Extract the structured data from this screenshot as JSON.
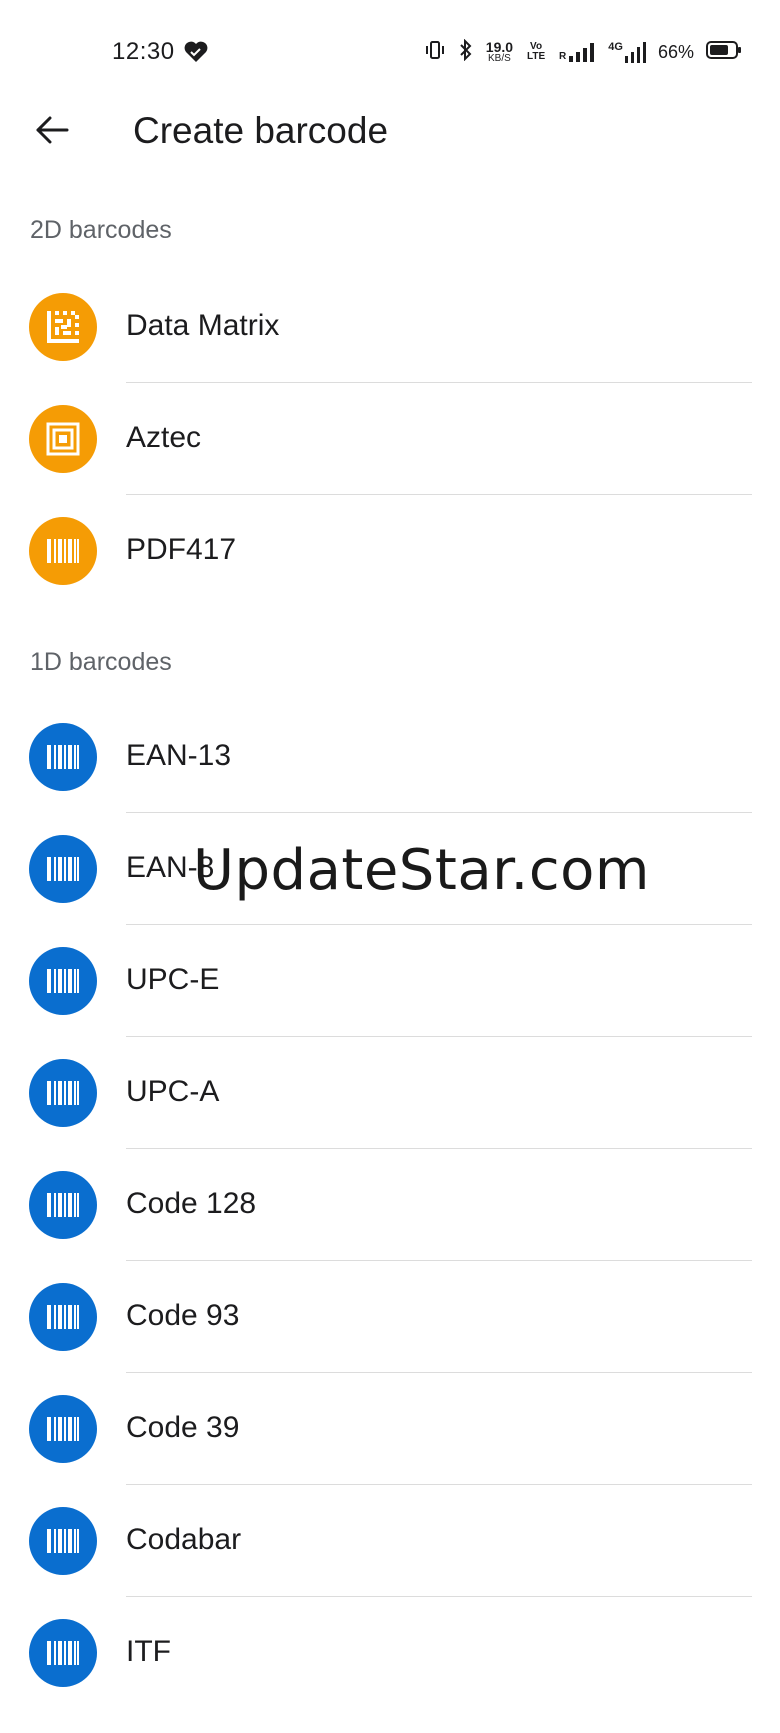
{
  "status_bar": {
    "time": "12:30",
    "net_speed_value": "19.0",
    "net_speed_unit": "KB/S",
    "volte_label": "Vo LTE",
    "roaming_label": "R",
    "network_label": "4G",
    "battery_percent": "66%",
    "icons": [
      "heart-icon",
      "vibrate-icon",
      "bluetooth-icon",
      "signal-icon",
      "battery-icon"
    ]
  },
  "app_bar": {
    "title": "Create barcode",
    "back_icon": "arrow-back-icon"
  },
  "sections": {
    "two_d": {
      "header": "2D barcodes",
      "items": [
        {
          "label": "Data Matrix",
          "icon": "data-matrix-icon"
        },
        {
          "label": "Aztec",
          "icon": "aztec-icon"
        },
        {
          "label": "PDF417",
          "icon": "pdf417-icon"
        }
      ]
    },
    "one_d": {
      "header": "1D barcodes",
      "items": [
        {
          "label": "EAN-13",
          "icon": "barcode-icon"
        },
        {
          "label": "EAN-8",
          "icon": "barcode-icon"
        },
        {
          "label": "UPC-E",
          "icon": "barcode-icon"
        },
        {
          "label": "UPC-A",
          "icon": "barcode-icon"
        },
        {
          "label": "Code 128",
          "icon": "barcode-icon"
        },
        {
          "label": "Code 93",
          "icon": "barcode-icon"
        },
        {
          "label": "Code 39",
          "icon": "barcode-icon"
        },
        {
          "label": "Codabar",
          "icon": "barcode-icon"
        },
        {
          "label": "ITF",
          "icon": "barcode-icon"
        }
      ]
    }
  },
  "watermark": "UpdateStar.com",
  "colors": {
    "two_d_accent": "#f59c05",
    "one_d_accent": "#0a6ecf",
    "text_primary": "#1c1c1e",
    "text_secondary": "#5f6368",
    "divider": "#dcdcdc"
  }
}
